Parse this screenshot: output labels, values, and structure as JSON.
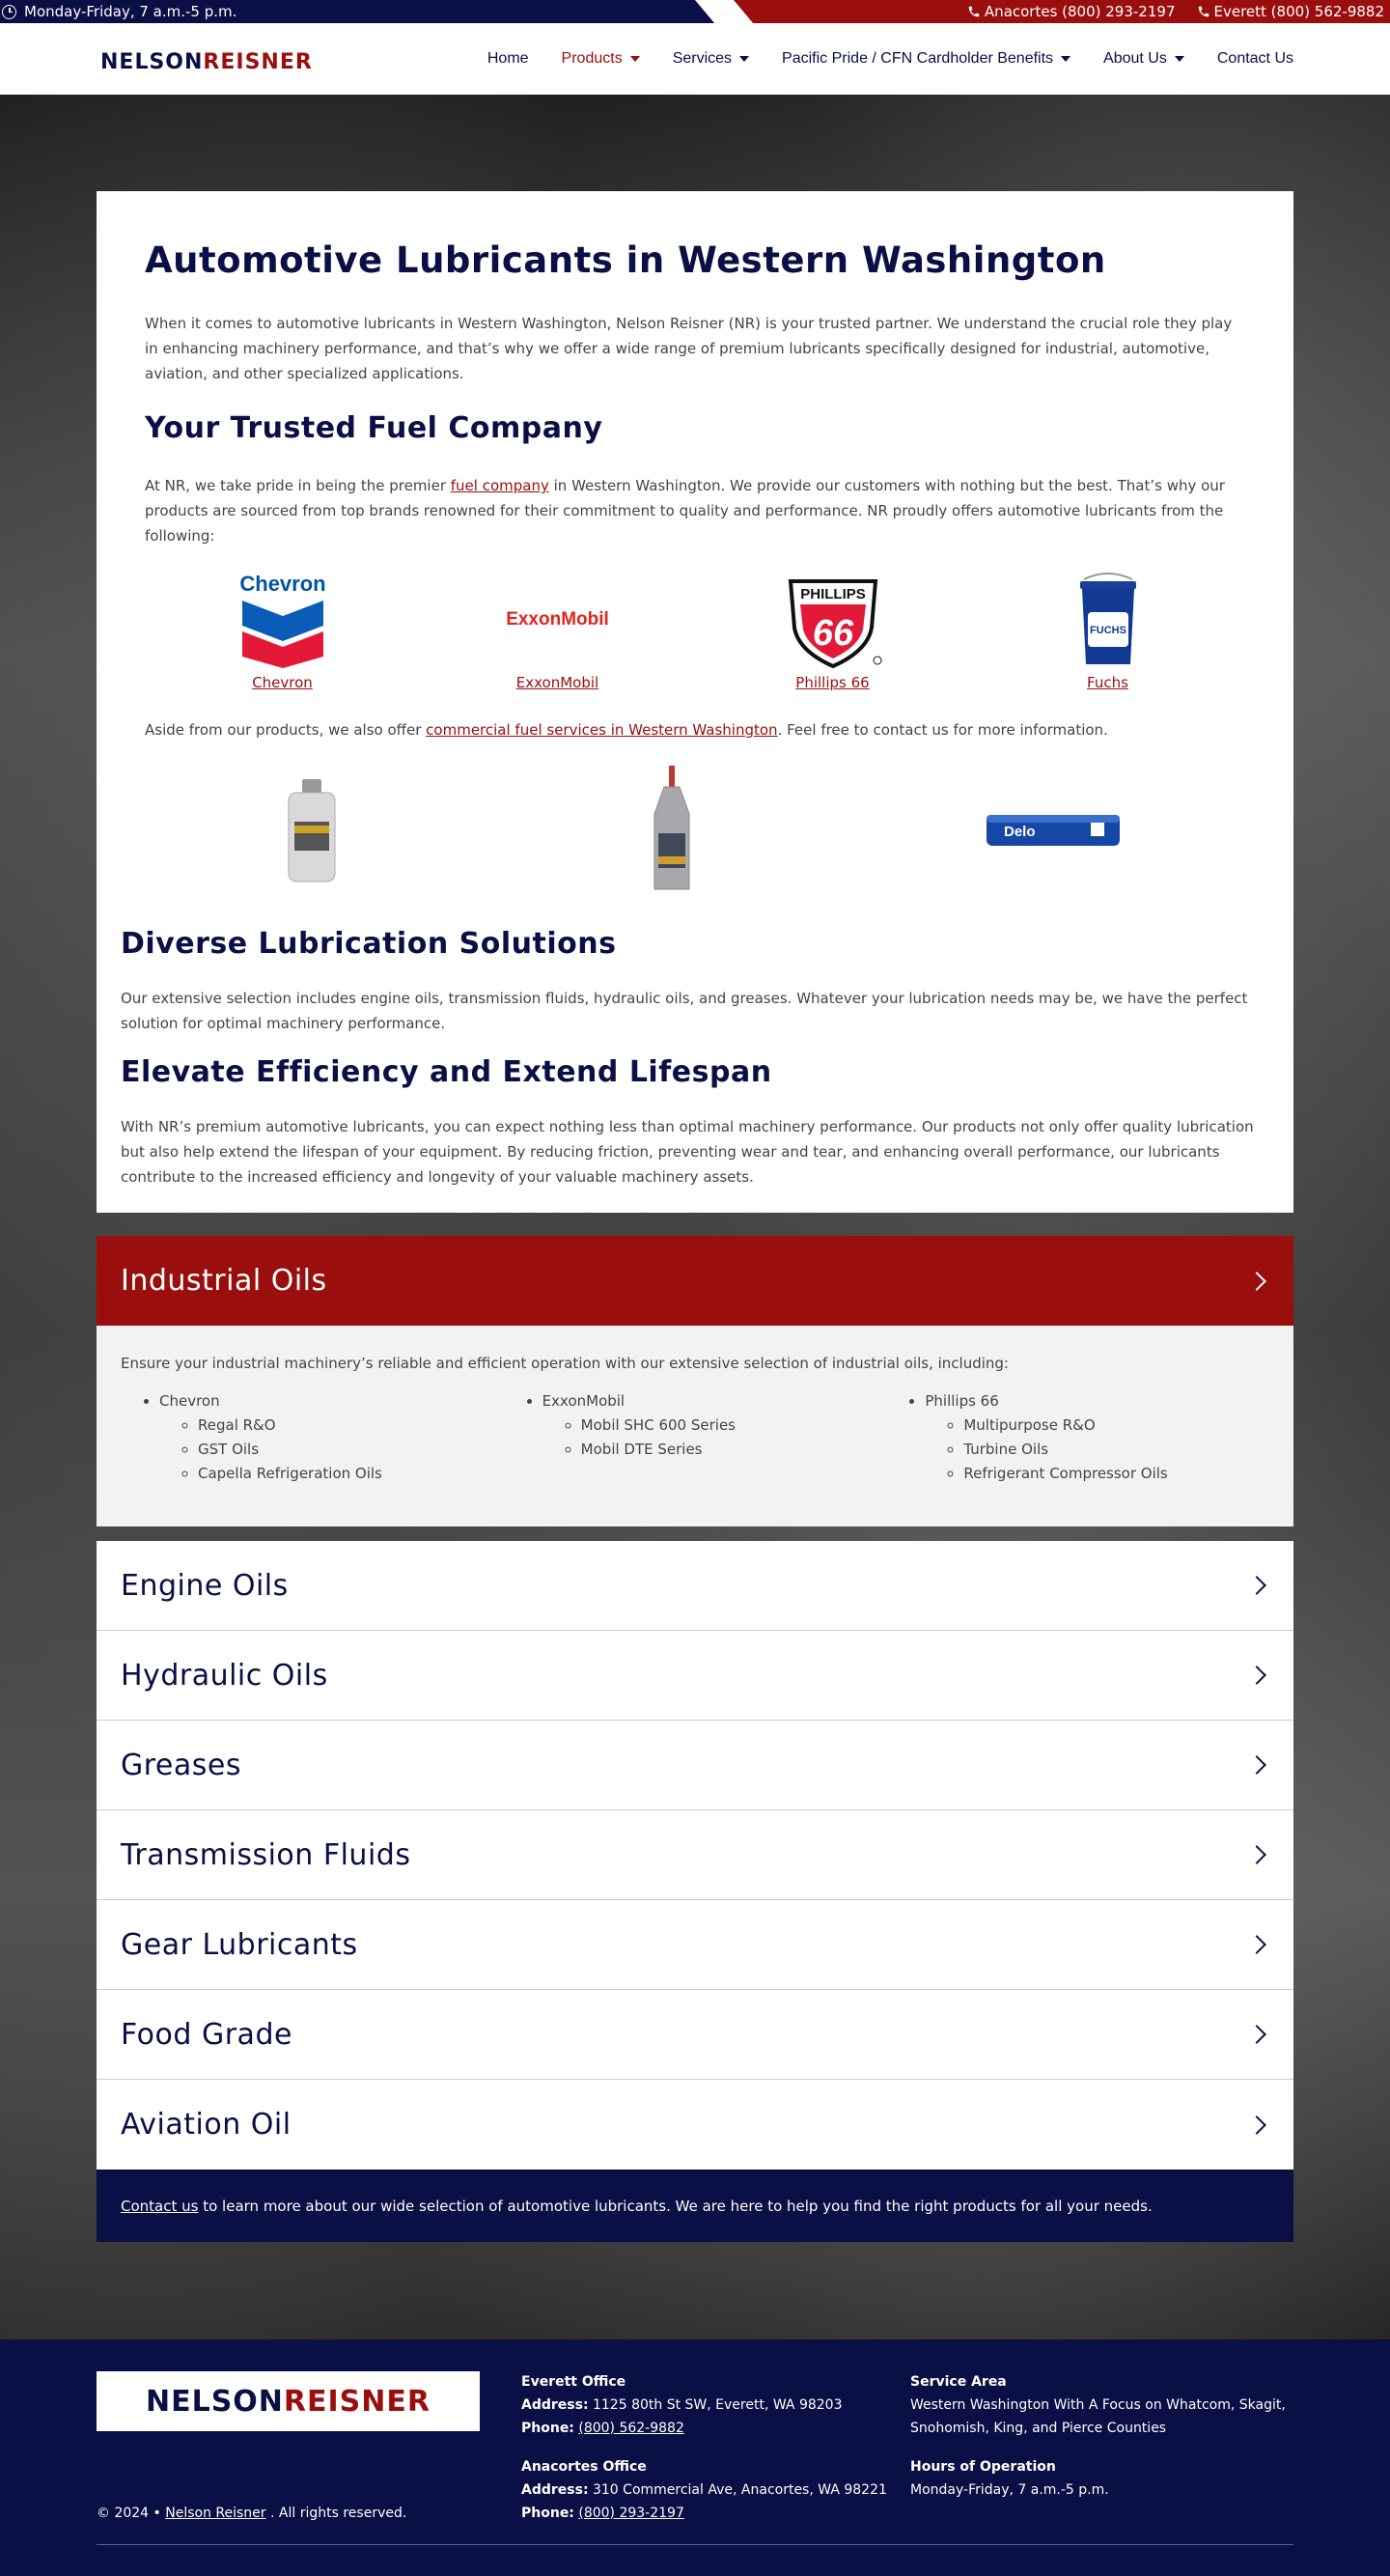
{
  "topbar": {
    "hours": "Monday-Friday, 7 a.m.-5 p.m.",
    "phone_anacortes": "Anacortes (800) 293-2197",
    "phone_everett": "Everett (800) 562-9882"
  },
  "header": {
    "logo_part1": "NELSON",
    "logo_part2": "REISNER",
    "nav": [
      {
        "label": "Home"
      },
      {
        "label": "Products"
      },
      {
        "label": "Services"
      },
      {
        "label": "Pacific Pride / CFN Cardholder Benefits"
      },
      {
        "label": "About Us"
      },
      {
        "label": "Contact Us"
      }
    ]
  },
  "intro": {
    "title": "Automotive Lubricants in Western Washington",
    "p1": "When it comes to automotive lubricants in Western Washington, Nelson Reisner (NR) is your trusted partner. We understand the crucial role they play in enhancing machinery performance, and that’s why we offer a wide range of premium lubricants specifically designed for industrial, automotive, aviation, and other specialized applications.",
    "h2_trusted": "Your Trusted Fuel Company",
    "p2_before": "At NR, we take pride in being the premier ",
    "p2_link": "fuel company",
    "p2_after": " in Western Washington. We provide our customers with nothing but the best. That’s why our products are sourced from top brands renowned for their commitment to quality and performance. NR proudly offers automotive lubricants from the following:",
    "brands": [
      {
        "name": "Chevron"
      },
      {
        "name": "ExxonMobil"
      },
      {
        "name": "Phillips 66"
      },
      {
        "name": "Fuchs"
      }
    ],
    "brand_logo_text": {
      "exxon": "ExxonMobil",
      "phillips_top": "PHILLIPS",
      "phillips_num": "66",
      "fuchs": "FUCHS",
      "delo": "Delo"
    },
    "p3_before": "Aside from our products, we also offer ",
    "p3_link": "commercial fuel services in Western Washington",
    "p3_after": ". Feel free to contact us for more information.",
    "h2_diverse": "Diverse Lubrication Solutions",
    "p4": "Our extensive selection includes engine oils, transmission fluids, hydraulic oils, and greases. Whatever your lubrication needs may be, we have the perfect solution for optimal machinery performance.",
    "h2_elevate": "Elevate Efficiency and Extend Lifespan",
    "p5": "With NR’s premium automotive lubricants, you can expect nothing less than optimal machinery performance. Our products not only offer quality lubrication but also help extend the lifespan of your equipment. By reducing friction, preventing wear and tear, and enhancing overall performance, our lubricants contribute to the increased efficiency and longevity of your valuable machinery assets."
  },
  "accordion": {
    "industrial": {
      "title": "Industrial Oils",
      "intro": "Ensure your industrial machinery’s reliable and efficient operation with our extensive selection of industrial oils, including:",
      "chevron": {
        "name": "Chevron",
        "items": [
          "Regal R&O",
          "GST Oils",
          "Capella Refrigeration Oils"
        ]
      },
      "exxon": {
        "name": "ExxonMobil",
        "items": [
          "Mobil SHC 600 Series",
          "Mobil DTE Series"
        ]
      },
      "phillips": {
        "name": "Phillips 66",
        "items": [
          "Multipurpose R&O",
          "Turbine Oils",
          "Refrigerant Compressor Oils"
        ]
      }
    },
    "closed": [
      {
        "title": "Engine Oils"
      },
      {
        "title": "Hydraulic Oils"
      },
      {
        "title": "Greases"
      },
      {
        "title": "Transmission Fluids"
      },
      {
        "title": "Gear Lubricants"
      },
      {
        "title": "Food Grade"
      },
      {
        "title": "Aviation Oil"
      }
    ]
  },
  "cta": {
    "link": "Contact us",
    "text": " to learn more about our wide selection of automotive lubricants. We are here to help you find the right products for all your needs."
  },
  "footer": {
    "copyright_prefix": "© 2024 • ",
    "copyright_link": "Nelson Reisner",
    "copyright_suffix": " . All rights reserved.",
    "everett": {
      "heading": "Everett Office",
      "address_label": "Address:",
      "address": " 1125 80th St SW, Everett, WA 98203",
      "phone_label": "Phone:",
      "phone": "(800) 562-9882"
    },
    "anacortes": {
      "heading": "Anacortes Office",
      "address_label": "Address:",
      "address": " 310 Commercial Ave, Anacortes, WA 98221",
      "phone_label": "Phone:",
      "phone": "(800) 293-2197"
    },
    "service_area": {
      "heading": "Service Area",
      "text": "Western Washington With A Focus on Whatcom, Skagit, Snohomish, King, and Pierce Counties"
    },
    "hours": {
      "heading": "Hours of Operation",
      "text": "Monday-Friday, 7 a.m.-5 p.m."
    }
  },
  "colors": {
    "navy": "#0a0f45",
    "red": "#9b0e0e",
    "light_gray": "#f2f2f2"
  }
}
